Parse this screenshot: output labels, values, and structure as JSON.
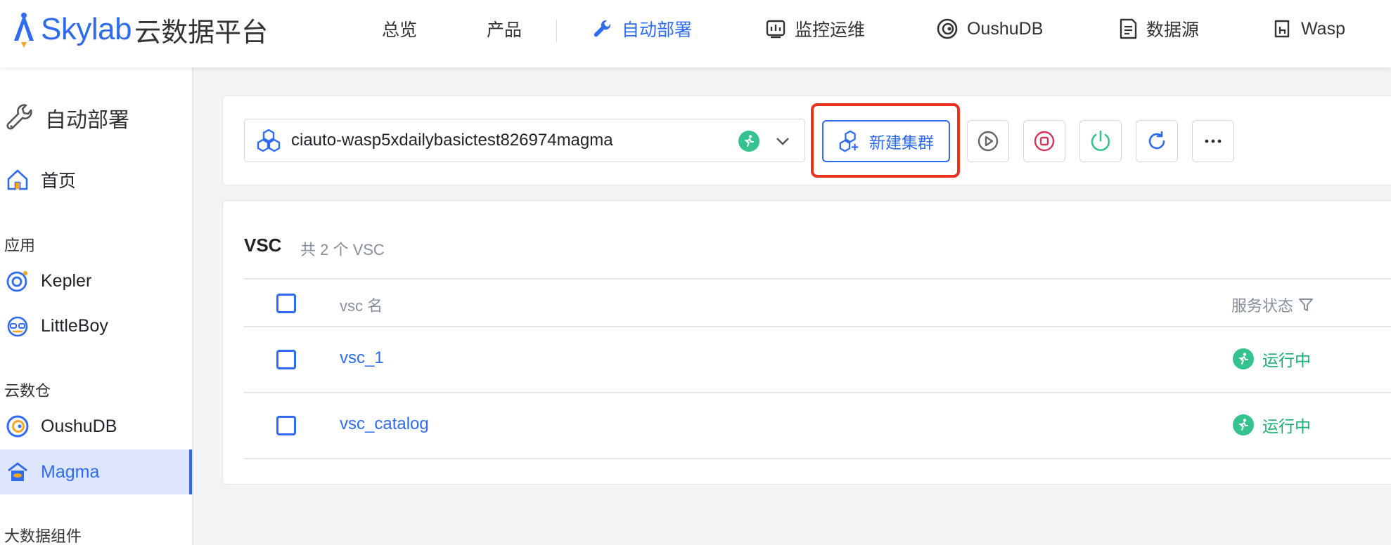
{
  "brand": {
    "name": "Skylab",
    "subtitle": "云数据平台"
  },
  "nav": [
    {
      "label": "总览"
    },
    {
      "label": "产品"
    },
    {
      "label": "自动部署",
      "active": true
    },
    {
      "label": "监控运维"
    },
    {
      "label": "OushuDB"
    },
    {
      "label": "数据源"
    },
    {
      "label": "Wasp"
    }
  ],
  "sidebar": {
    "title": "自动部署",
    "home": "首页",
    "groups": [
      {
        "label": "应用",
        "items": [
          "Kepler",
          "LittleBoy"
        ]
      },
      {
        "label": "云数仓",
        "items": [
          "OushuDB",
          "Magma"
        ]
      },
      {
        "label": "大数据组件",
        "items": []
      }
    ],
    "active_item": "Magma"
  },
  "toolbar": {
    "cluster_select": {
      "value": "ciauto-wasp5xdailybasictest826974magma",
      "status_icon": "running-icon"
    },
    "new_cluster_label": "新建集群",
    "actions": [
      "play-icon",
      "stop-icon",
      "power-icon",
      "refresh-icon",
      "more-icon"
    ]
  },
  "table": {
    "title": "VSC",
    "count_text": "共 2 个 VSC",
    "columns": {
      "name": "vsc 名",
      "status": "服务状态"
    },
    "rows": [
      {
        "name": "vsc_1",
        "status": "运行中"
      },
      {
        "name": "vsc_catalog",
        "status": "运行中"
      }
    ]
  },
  "colors": {
    "accent": "#2f6bef",
    "running": "#34c38f",
    "highlight": "#e8321e"
  }
}
